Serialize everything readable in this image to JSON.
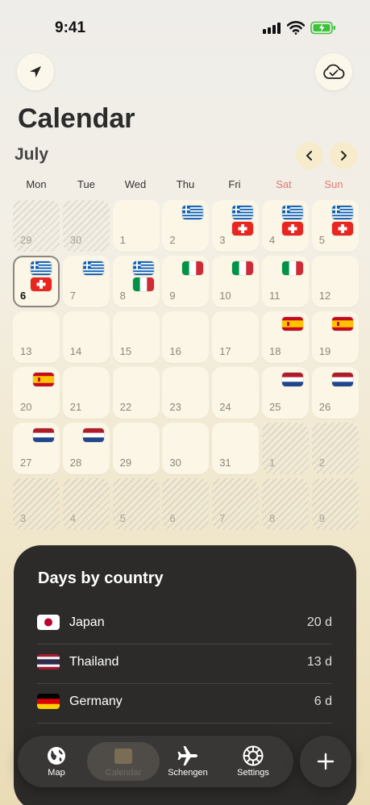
{
  "status": {
    "time": "9:41"
  },
  "header": {
    "title": "Calendar",
    "month": "July"
  },
  "weekdays": [
    "Mon",
    "Tue",
    "Wed",
    "Thu",
    "Fri",
    "Sat",
    "Sun"
  ],
  "colors": {
    "weekend": "#e07a72",
    "sheet": "#2c2b2a",
    "battery": "#3cc13b"
  },
  "calendar": {
    "today": 6,
    "cells": [
      {
        "day": "29",
        "out": true,
        "flags": []
      },
      {
        "day": "30",
        "out": true,
        "flags": []
      },
      {
        "day": "1",
        "flags": []
      },
      {
        "day": "2",
        "flags": [
          "greece"
        ]
      },
      {
        "day": "3",
        "flags": [
          "greece",
          "switzerland"
        ]
      },
      {
        "day": "4",
        "flags": [
          "greece",
          "switzerland"
        ]
      },
      {
        "day": "5",
        "flags": [
          "greece",
          "switzerland"
        ]
      },
      {
        "day": "6",
        "flags": [
          "greece",
          "switzerland"
        ],
        "today": true
      },
      {
        "day": "7",
        "flags": [
          "greece"
        ]
      },
      {
        "day": "8",
        "flags": [
          "greece",
          "italy"
        ]
      },
      {
        "day": "9",
        "flags": [
          "italy"
        ]
      },
      {
        "day": "10",
        "flags": [
          "italy"
        ]
      },
      {
        "day": "11",
        "flags": [
          "italy"
        ]
      },
      {
        "day": "12",
        "flags": []
      },
      {
        "day": "13",
        "flags": []
      },
      {
        "day": "14",
        "flags": []
      },
      {
        "day": "15",
        "flags": []
      },
      {
        "day": "16",
        "flags": []
      },
      {
        "day": "17",
        "flags": []
      },
      {
        "day": "18",
        "flags": [
          "spain"
        ]
      },
      {
        "day": "19",
        "flags": [
          "spain"
        ]
      },
      {
        "day": "20",
        "flags": [
          "spain"
        ]
      },
      {
        "day": "21",
        "flags": []
      },
      {
        "day": "22",
        "flags": []
      },
      {
        "day": "23",
        "flags": []
      },
      {
        "day": "24",
        "flags": []
      },
      {
        "day": "25",
        "flags": [
          "netherlands"
        ]
      },
      {
        "day": "26",
        "flags": [
          "netherlands"
        ]
      },
      {
        "day": "27",
        "flags": [
          "netherlands"
        ]
      },
      {
        "day": "28",
        "flags": [
          "netherlands"
        ]
      },
      {
        "day": "29",
        "flags": []
      },
      {
        "day": "30",
        "flags": []
      },
      {
        "day": "31",
        "flags": []
      },
      {
        "day": "1",
        "out": true,
        "flags": []
      },
      {
        "day": "2",
        "out": true,
        "flags": []
      },
      {
        "day": "3",
        "out": true,
        "flags": []
      },
      {
        "day": "4",
        "out": true,
        "flags": []
      },
      {
        "day": "5",
        "out": true,
        "flags": []
      },
      {
        "day": "6",
        "out": true,
        "flags": []
      },
      {
        "day": "7",
        "out": true,
        "flags": []
      },
      {
        "day": "8",
        "out": true,
        "flags": []
      },
      {
        "day": "9",
        "out": true,
        "flags": []
      }
    ]
  },
  "sheet": {
    "title": "Days by country",
    "rows": [
      {
        "country": "Japan",
        "days": "20 d",
        "flag": "japan"
      },
      {
        "country": "Thailand",
        "days": "13 d",
        "flag": "thailand"
      },
      {
        "country": "Germany",
        "days": "6 d",
        "flag": "germany"
      }
    ]
  },
  "tabs": [
    {
      "label": "Map",
      "icon": "globe-icon"
    },
    {
      "label": "Calendar",
      "icon": "calendar-icon",
      "active": true
    },
    {
      "label": "Schengen",
      "icon": "airplane-icon"
    },
    {
      "label": "Settings",
      "icon": "gear-icon"
    }
  ],
  "icons": {
    "top_left": "location-arrow-icon",
    "top_right": "cloud-check-icon",
    "add": "plus-icon"
  }
}
